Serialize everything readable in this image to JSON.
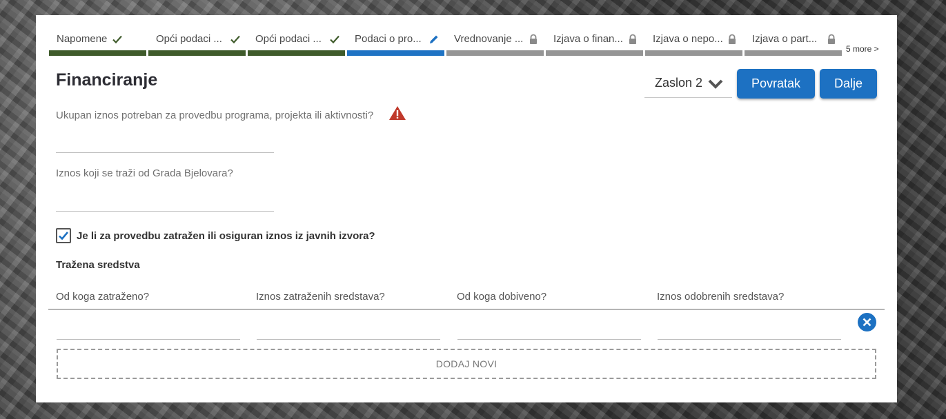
{
  "stepper": {
    "steps": [
      {
        "label": "Napomene",
        "status": "done",
        "icon": "check-icon"
      },
      {
        "label": "Opći podaci ...",
        "status": "done",
        "icon": "check-icon"
      },
      {
        "label": "Opći podaci ...",
        "status": "done",
        "icon": "check-icon"
      },
      {
        "label": "Podaci o pro...",
        "status": "active",
        "icon": "pencil-icon"
      },
      {
        "label": "Vrednovanje ...",
        "status": "locked",
        "icon": "lock-icon"
      },
      {
        "label": "Izjava o finan...",
        "status": "locked",
        "icon": "lock-icon"
      },
      {
        "label": "Izjava o nepo...",
        "status": "locked",
        "icon": "lock-icon"
      },
      {
        "label": "Izjava o part...",
        "status": "locked",
        "icon": "lock-icon"
      }
    ],
    "more_label": "5 more >"
  },
  "header": {
    "title": "Financiranje",
    "screen_select": "Zaslon 2",
    "back_label": "Povratak",
    "next_label": "Dalje"
  },
  "form": {
    "total_amount_label": "Ukupan iznos potreban za provedbu programa, projekta ili aktivnosti?",
    "total_amount_value": "",
    "requested_amount_label": "Iznos koji se traži od Grada Bjelovara?",
    "requested_amount_value": "",
    "public_sources_label": "Je li za provedbu zatražen ili osiguran iznos iz javnih izvora?",
    "public_sources_checked": true,
    "section_title": "Tražena sredstva"
  },
  "table": {
    "columns": [
      "Od koga zatraženo?",
      "Iznos zatraženih sredstava?",
      "Od koga dobiveno?",
      "Iznos odobrenih sredstava?"
    ],
    "rows": [
      [
        "",
        "",
        "",
        ""
      ]
    ],
    "add_label": "DODAJ NOVI"
  },
  "colors": {
    "accent": "#1d71c2",
    "done": "#3f5b2b",
    "locked": "#959595",
    "warning": "#c0392b",
    "title": "#2d2d34"
  }
}
